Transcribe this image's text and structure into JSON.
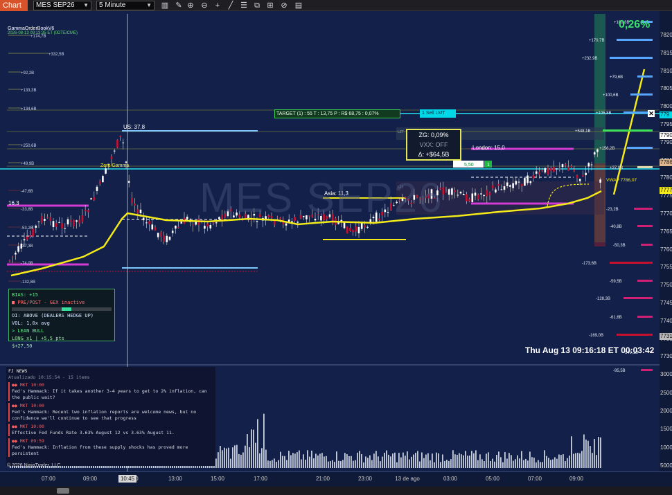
{
  "toolbar": {
    "tab_label": "Chart",
    "instrument": "MES SEP26",
    "timeframe": "5 Minute",
    "icons": [
      "bar-chart-icon",
      "pencil-icon",
      "zoom-in-icon",
      "zoom-out-icon",
      "crosshair-icon",
      "draw-line-icon",
      "bar-type-icon",
      "properties-icon",
      "grid-icon",
      "time-icon",
      "horizontal-line-icon",
      "list-icon"
    ]
  },
  "indicator": {
    "name": "GammaOrderBookV6",
    "subtitle": "2026-08-13 09:13:35 ET (0DTE/CME)"
  },
  "watermark": "MES SEP26",
  "percent_change": "0,26%",
  "clock": "Thu Aug 13 09:16:18 ET  00:03:42",
  "copyright": "© 2026 NinjaTrader, LLC",
  "cursor_time": "10:45",
  "target_box": "TARGET (1) : 55 T : 13,75 P : R$ 68,75 : 0,07%",
  "sell_lmt": "1  Sell LMT",
  "zg_box": {
    "line1": "ZG: 0,09%",
    "line2": "VXX: OFF",
    "line3": "Δ: +$64,5B"
  },
  "chart_labels": {
    "us": "US: 37,8",
    "asia": "Asia: 11,3",
    "london": "London: 15,0",
    "zero_gamma": "Zero Gamma",
    "vwap": "VWAP 7786,07",
    "level_163": "16,3",
    "lzt1": "LZT",
    "lzt2": "LZT",
    "qty_5_50": "5,50",
    "qty_1": "1"
  },
  "left_gex_labels": [
    "+174,7B",
    "+332,5B",
    "+92,2B",
    "+133,3B",
    "+134,6B",
    "+250,6B",
    "+49,9B",
    "-47,6B",
    "-33,8B",
    "-53,2B",
    "-37,3B",
    "-74,0B",
    "-132,8B",
    "-40,0B"
  ],
  "right_gex_labels": [
    "+100,8B",
    "+170,7B",
    "+232,9B",
    "+79,6B",
    "+100,6B",
    "+105,8B",
    "+548,1B",
    "+156,2B",
    "+37,0B",
    "-23,2B",
    "-40,8B",
    "-50,3B",
    "-173,6B",
    "-59,5B",
    "-128,3B",
    "-61,6B",
    "-169,0B",
    "-149,1B",
    "-95,5B"
  ],
  "bias": {
    "title": "BIAS: +15",
    "warning": "■ PRE/POST - GEX inactive",
    "oi": "OI: ABOVE (DEALERS HEDGE UP)",
    "vol": "VOL: 1,0x avg",
    "lean": "> LEAN BULL",
    "position": "LONG x1 | +5,5 pts",
    "pnl": "$+27,50"
  },
  "news": {
    "header": "FJ NEWS",
    "updated": "Atualizado 10:15:54 - 15 items",
    "items": [
      {
        "tag": "●● MKT   10:00",
        "text": "Fed's Hammack: If it takes another 3-4 years to get to 2% inflation, can the public wait?"
      },
      {
        "tag": "●● MKT   10:00",
        "text": "Fed's Hammack: Recent two inflation reports are welcome news, but no confidence we'll continue to see that progress"
      },
      {
        "tag": "●● MKT   10:00",
        "text": "Effective Fed Funds Rate 3.63% August 12 vs 3.63% August 11."
      },
      {
        "tag": "●● MKT   09:59",
        "text": "Fed's Hammack: Inflation from these supply shocks has proved more persistent"
      }
    ]
  },
  "price_axis": [
    "7820",
    "7815",
    "7810",
    "7805",
    "7800",
    "7795",
    "7790",
    "7785",
    "7780",
    "7775",
    "7770",
    "7765",
    "7760",
    "7755",
    "7750",
    "7745",
    "7740",
    "7735",
    "7730"
  ],
  "price_markers": {
    "sell": "779",
    "last": "7790",
    "vwap": "7786",
    "current": "7777",
    "lower": "7731"
  },
  "volume_axis": [
    "3000",
    "2500",
    "2000",
    "1500",
    "1000",
    "5000",
    "332"
  ],
  "time_axis": [
    "07:00",
    "09:00",
    "11:00",
    "13:00",
    "15:00",
    "17:00",
    "21:00",
    "23:00",
    "13 de ago",
    "03:00",
    "05:00",
    "07:00",
    "09:00"
  ],
  "colors": {
    "bull": "#ffffff",
    "bear": "#c8102e",
    "vwap": "#f4ea1a",
    "gex_pos": "#58a6ff",
    "gex_neg": "#d21f74",
    "accent": "#d9532a"
  }
}
